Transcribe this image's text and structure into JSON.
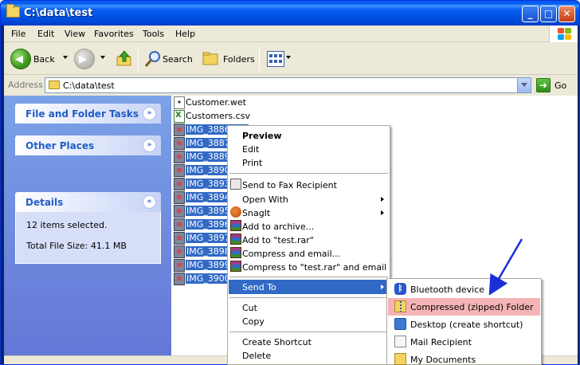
{
  "window": {
    "title": "C:\\data\\test",
    "min_label": "_",
    "max_label": "□",
    "close_label": "✕"
  },
  "menubar": {
    "items": [
      "File",
      "Edit",
      "View",
      "Favorites",
      "Tools",
      "Help"
    ]
  },
  "toolbar": {
    "back_label": "Back",
    "search_label": "Search",
    "folders_label": "Folders"
  },
  "address": {
    "label": "Address",
    "value": "C:\\data\\test",
    "go_label": "Go"
  },
  "taskpane": {
    "file_folder_tasks": "File and Folder Tasks",
    "other_places": "Other Places",
    "details": "Details",
    "details_selected": "12 items selected.",
    "details_size": "Total File Size: 41.1 MB"
  },
  "files": [
    {
      "name": "Customer.wet",
      "type": "wet",
      "selected": false
    },
    {
      "name": "Customers.csv",
      "type": "csv",
      "selected": false
    },
    {
      "name": "IMG_3886.JPG",
      "type": "img",
      "selected": true
    },
    {
      "name": "IMG_3887.JPG",
      "type": "img",
      "selected": true
    },
    {
      "name": "IMG_3889.JPG",
      "type": "img",
      "selected": true
    },
    {
      "name": "IMG_3890.JPG",
      "type": "img",
      "selected": true
    },
    {
      "name": "IMG_3893.JPG",
      "type": "img",
      "selected": true
    },
    {
      "name": "IMG_3894.JPG",
      "type": "img",
      "selected": true
    },
    {
      "name": "IMG_3895.JPG",
      "type": "img",
      "selected": true
    },
    {
      "name": "IMG_3896.JPG",
      "type": "img",
      "selected": true
    },
    {
      "name": "IMG_3897.JPG",
      "type": "img",
      "selected": true
    },
    {
      "name": "IMG_3898.JPG",
      "type": "img",
      "selected": true
    },
    {
      "name": "IMG_3899.JPG",
      "type": "img",
      "selected": true
    },
    {
      "name": "IMG_3900.JPG",
      "type": "img",
      "selected": true
    }
  ],
  "context_menu": {
    "preview": "Preview",
    "edit": "Edit",
    "print": "Print",
    "send_fax": "Send to Fax Recipient",
    "open_with": "Open With",
    "snagit": "SnagIt",
    "add_archive": "Add to archive...",
    "add_rar": "Add to \"test.rar\"",
    "compress_email": "Compress and email...",
    "compress_rar_email": "Compress to \"test.rar\" and email",
    "send_to": "Send To",
    "cut": "Cut",
    "copy": "Copy",
    "create_shortcut": "Create Shortcut",
    "delete": "Delete"
  },
  "send_to_menu": {
    "bluetooth": "Bluetooth device",
    "compressed": "Compressed (zipped) Folder",
    "desktop": "Desktop (create shortcut)",
    "mail": "Mail Recipient",
    "my_documents": "My Documents"
  },
  "colors": {
    "selection": "#316ac5",
    "highlight_pink": "#f4b4b6",
    "task_pane": "#6375d6",
    "annotation_arrow": "#1a2fd6"
  }
}
